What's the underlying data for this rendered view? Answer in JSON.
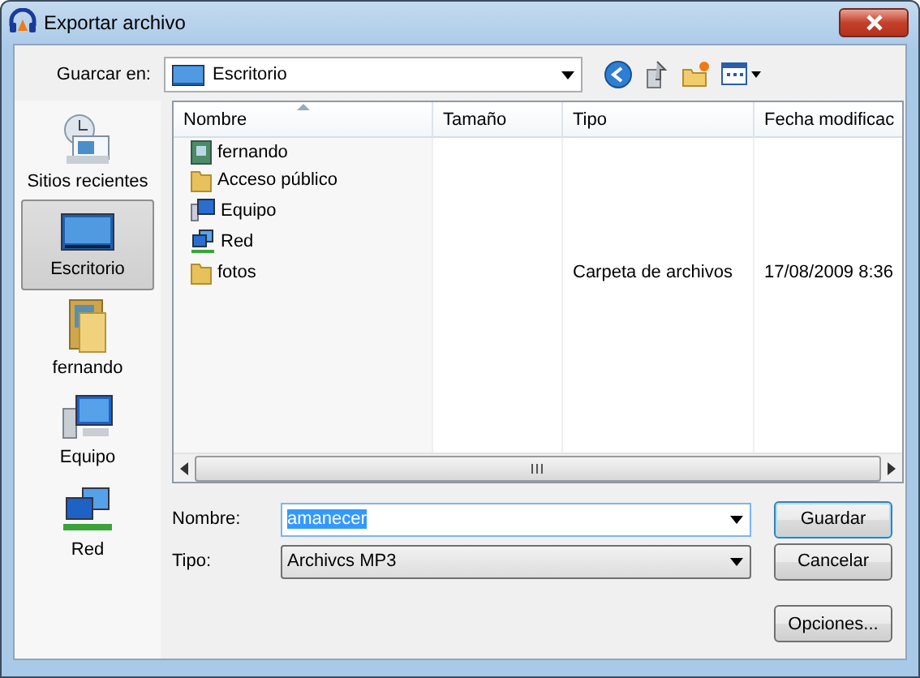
{
  "window": {
    "title": "Exportar archivo"
  },
  "location": {
    "label": "Guarcar en:",
    "value": "Escritorio"
  },
  "places": [
    {
      "label": "Sitios recientes",
      "kind": "recent",
      "selected": false
    },
    {
      "label": "Escritorio",
      "kind": "desktop",
      "selected": true
    },
    {
      "label": "fernando",
      "kind": "user",
      "selected": false
    },
    {
      "label": "Equipo",
      "kind": "computer",
      "selected": false
    },
    {
      "label": "Red",
      "kind": "network",
      "selected": false
    }
  ],
  "table": {
    "columns": [
      {
        "label": "Nombre",
        "sorted": true
      },
      {
        "label": "Tamaño",
        "sorted": false
      },
      {
        "label": "Tipo",
        "sorted": false
      },
      {
        "label": "Fecha modificac",
        "sorted": false
      }
    ],
    "rows": [
      {
        "kind": "user",
        "name": "fernando"
      },
      {
        "kind": "folder",
        "name": "Acceso público"
      },
      {
        "kind": "computer",
        "name": "Equipo"
      },
      {
        "kind": "network",
        "name": "Red"
      },
      {
        "kind": "folder",
        "name": "fotos",
        "type": "Carpeta de archivos",
        "date": "17/08/2009 8:36"
      }
    ]
  },
  "filename": {
    "label": "Nombre:",
    "value": "amanecer",
    "value_selected": true
  },
  "filetype": {
    "label": "Tipo:",
    "value": "Archivcs MP3"
  },
  "buttons": [
    {
      "label": "Guardar",
      "default": true
    },
    {
      "label": "Cancelar",
      "default": false
    },
    {
      "label": "Opciones...",
      "default": false
    }
  ]
}
